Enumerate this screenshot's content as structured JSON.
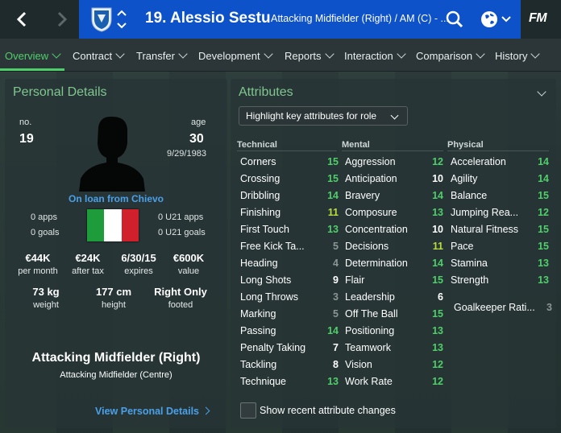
{
  "header": {
    "player_title": "19. Alessio Sestu",
    "player_role": "Attacking Midfielder (Right) / AM (C) - ...",
    "logo_text": "FM"
  },
  "tabs": [
    {
      "label": "Overview",
      "active": true
    },
    {
      "label": "Contract"
    },
    {
      "label": "Transfer"
    },
    {
      "label": "Development"
    },
    {
      "label": "Reports"
    },
    {
      "label": "Interaction"
    },
    {
      "label": "Comparison"
    },
    {
      "label": "History"
    }
  ],
  "personal": {
    "title": "Personal Details",
    "no_label": "no.",
    "no_value": "19",
    "age_label": "age",
    "age_value": "30",
    "dob": "9/29/1983",
    "loan_text": "On loan from Chievo",
    "apps": "0 apps",
    "goals": "0 goals",
    "u21_apps": "0 U21 apps",
    "u21_goals": "0 U21 goals",
    "stats1": [
      {
        "value": "€44K",
        "label": "per month"
      },
      {
        "value": "€24K",
        "label": "after tax"
      },
      {
        "value": "6/30/15",
        "label": "expires"
      },
      {
        "value": "€600K",
        "label": "value"
      }
    ],
    "stats2": [
      {
        "value": "73 kg",
        "label": "weight"
      },
      {
        "value": "177 cm",
        "label": "height"
      },
      {
        "value": "Right Only",
        "label": "footed"
      }
    ],
    "position_main": "Attacking Midfielder (Right)",
    "position_secondary": "Attacking Midfielder (Centre)",
    "view_link": "View Personal Details",
    "flag_colors": [
      "#1e9b3a",
      "#ffffff",
      "#d0202c"
    ]
  },
  "attributes": {
    "title": "Attributes",
    "highlight_dropdown": "Highlight key attributes for role",
    "show_changes_label": "Show recent attribute changes",
    "columns": [
      {
        "heading": "Technical",
        "items": [
          {
            "name": "Corners",
            "value": "15",
            "tone": "green"
          },
          {
            "name": "Crossing",
            "value": "15",
            "tone": "green"
          },
          {
            "name": "Dribbling",
            "value": "14",
            "tone": "green"
          },
          {
            "name": "Finishing",
            "value": "11",
            "tone": "yellow"
          },
          {
            "name": "First Touch",
            "value": "13",
            "tone": "green"
          },
          {
            "name": "Free Kick Ta...",
            "value": "5",
            "tone": "grey"
          },
          {
            "name": "Heading",
            "value": "4",
            "tone": "grey"
          },
          {
            "name": "Long Shots",
            "value": "9",
            "tone": "white"
          },
          {
            "name": "Long Throws",
            "value": "3",
            "tone": "grey"
          },
          {
            "name": "Marking",
            "value": "5",
            "tone": "grey"
          },
          {
            "name": "Passing",
            "value": "14",
            "tone": "green"
          },
          {
            "name": "Penalty Taking",
            "value": "7",
            "tone": "white"
          },
          {
            "name": "Tackling",
            "value": "8",
            "tone": "white"
          },
          {
            "name": "Technique",
            "value": "13",
            "tone": "green"
          }
        ]
      },
      {
        "heading": "Mental",
        "items": [
          {
            "name": "Aggression",
            "value": "12",
            "tone": "green"
          },
          {
            "name": "Anticipation",
            "value": "10",
            "tone": "white"
          },
          {
            "name": "Bravery",
            "value": "14",
            "tone": "green"
          },
          {
            "name": "Composure",
            "value": "13",
            "tone": "green"
          },
          {
            "name": "Concentration",
            "value": "10",
            "tone": "white"
          },
          {
            "name": "Decisions",
            "value": "11",
            "tone": "yellow"
          },
          {
            "name": "Determination",
            "value": "14",
            "tone": "green"
          },
          {
            "name": "Flair",
            "value": "15",
            "tone": "green"
          },
          {
            "name": "Leadership",
            "value": "6",
            "tone": "white"
          },
          {
            "name": "Off The Ball",
            "value": "15",
            "tone": "green"
          },
          {
            "name": "Positioning",
            "value": "13",
            "tone": "green"
          },
          {
            "name": "Teamwork",
            "value": "13",
            "tone": "green"
          },
          {
            "name": "Vision",
            "value": "12",
            "tone": "green"
          },
          {
            "name": "Work Rate",
            "value": "12",
            "tone": "green"
          }
        ]
      },
      {
        "heading": "Physical",
        "items": [
          {
            "name": "Acceleration",
            "value": "14",
            "tone": "green"
          },
          {
            "name": "Agility",
            "value": "14",
            "tone": "green"
          },
          {
            "name": "Balance",
            "value": "15",
            "tone": "green"
          },
          {
            "name": "Jumping Rea...",
            "value": "12",
            "tone": "green"
          },
          {
            "name": "Natural Fitness",
            "value": "15",
            "tone": "green"
          },
          {
            "name": "Pace",
            "value": "15",
            "tone": "green"
          },
          {
            "name": "Stamina",
            "value": "13",
            "tone": "green"
          },
          {
            "name": "Strength",
            "value": "13",
            "tone": "green"
          }
        ],
        "goalkeeper": {
          "name": "Goalkeeper Rati...",
          "value": "3",
          "tone": "grey"
        }
      }
    ]
  }
}
